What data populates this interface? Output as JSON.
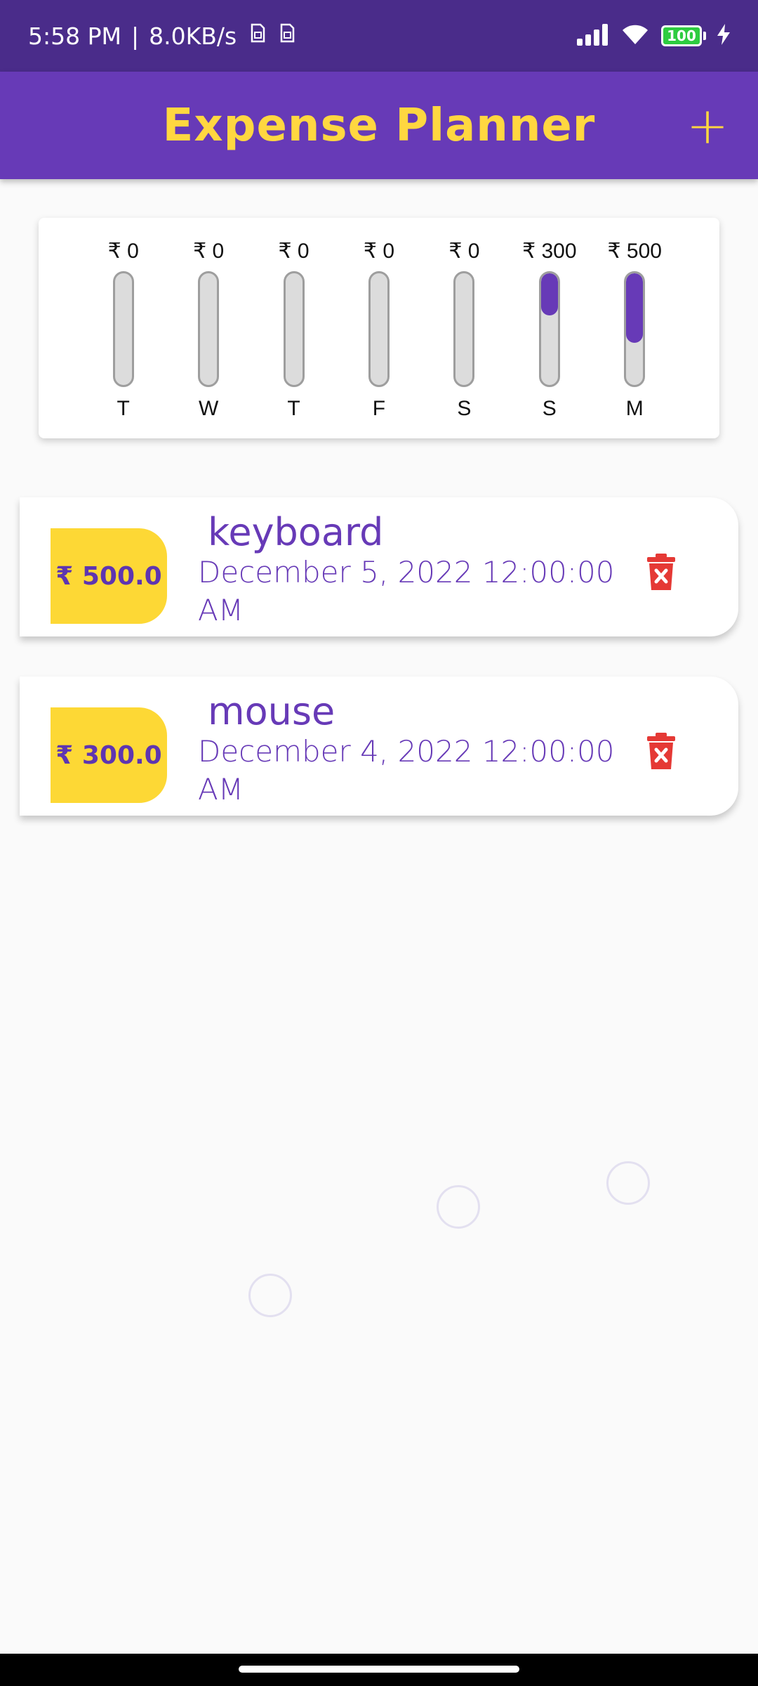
{
  "status_bar": {
    "time": "5:58 PM",
    "separator": "|",
    "network_speed": "8.0KB/s",
    "battery_level": "100"
  },
  "app_bar": {
    "title": "Expense Planner",
    "add_label": "+"
  },
  "chart": {
    "days": [
      {
        "label": "T",
        "amount": "₹ 0",
        "fraction": 0
      },
      {
        "label": "W",
        "amount": "₹ 0",
        "fraction": 0
      },
      {
        "label": "T",
        "amount": "₹ 0",
        "fraction": 0
      },
      {
        "label": "F",
        "amount": "₹ 0",
        "fraction": 0
      },
      {
        "label": "S",
        "amount": "₹ 0",
        "fraction": 0
      },
      {
        "label": "S",
        "amount": "₹ 300",
        "fraction": 0.375
      },
      {
        "label": "M",
        "amount": "₹ 500",
        "fraction": 0.625
      }
    ],
    "fill_color": "#673ab7"
  },
  "transactions": [
    {
      "amount": "₹ 500.0",
      "title": "keyboard",
      "date": "December 5, 2022 12:00:00 AM"
    },
    {
      "amount": "₹ 300.0",
      "title": "mouse",
      "date": "December 4, 2022 12:00:00 AM"
    }
  ],
  "colors": {
    "primary": "#673ab7",
    "accent": "#ffd740",
    "delete": "#e53935"
  }
}
